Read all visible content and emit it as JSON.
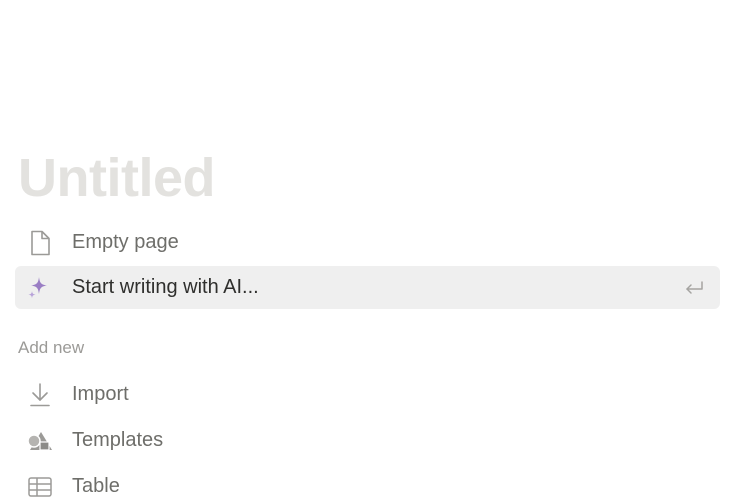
{
  "page": {
    "title": "Untitled"
  },
  "options": [
    {
      "label": "Empty page",
      "icon": "page-icon"
    },
    {
      "label": "Start writing with AI...",
      "icon": "ai-sparkle-icon",
      "shortcut_icon": "enter-icon"
    }
  ],
  "add_new": {
    "heading": "Add new",
    "items": [
      {
        "label": "Import",
        "icon": "import-icon"
      },
      {
        "label": "Templates",
        "icon": "templates-icon"
      },
      {
        "label": "Table",
        "icon": "table-icon"
      }
    ]
  },
  "colors": {
    "title_placeholder": "#e3e2df",
    "selected_background": "#efefef",
    "ai_accent": "#9a7ec4",
    "icon_gray": "#9b9a97"
  }
}
